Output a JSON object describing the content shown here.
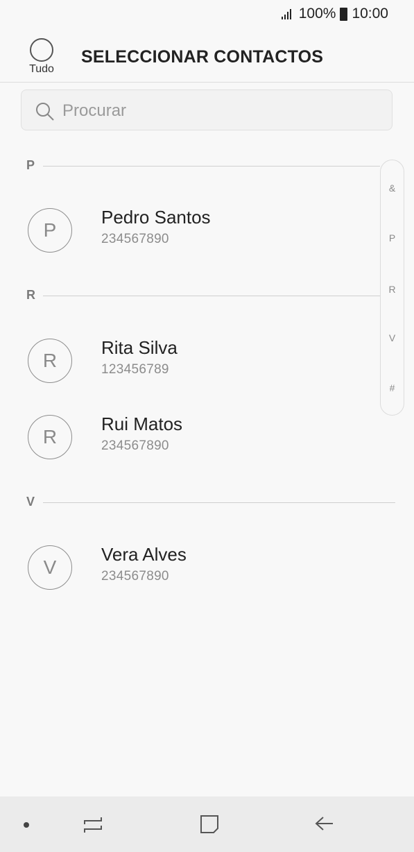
{
  "status_bar": {
    "battery": "100%",
    "time": "10:00"
  },
  "header": {
    "select_all_label": "Tudo",
    "title": "SELECCIONAR CONTACTOS"
  },
  "search": {
    "placeholder": "Procurar",
    "value": ""
  },
  "sections": [
    {
      "letter": "P",
      "contacts": [
        {
          "initial": "P",
          "name": "Pedro Santos",
          "phone": "234567890"
        }
      ]
    },
    {
      "letter": "R",
      "contacts": [
        {
          "initial": "R",
          "name": "Rita Silva",
          "phone": "123456789"
        },
        {
          "initial": "R",
          "name": "Rui Matos",
          "phone": "234567890"
        }
      ]
    },
    {
      "letter": "V",
      "contacts": [
        {
          "initial": "V",
          "name": "Vera Alves",
          "phone": "234567890"
        }
      ]
    }
  ],
  "index_bar": [
    "&",
    "P",
    "R",
    "V",
    "#"
  ],
  "nav_bar": {
    "icons": [
      "dot-icon",
      "recent-apps-icon",
      "home-icon",
      "back-icon"
    ]
  }
}
